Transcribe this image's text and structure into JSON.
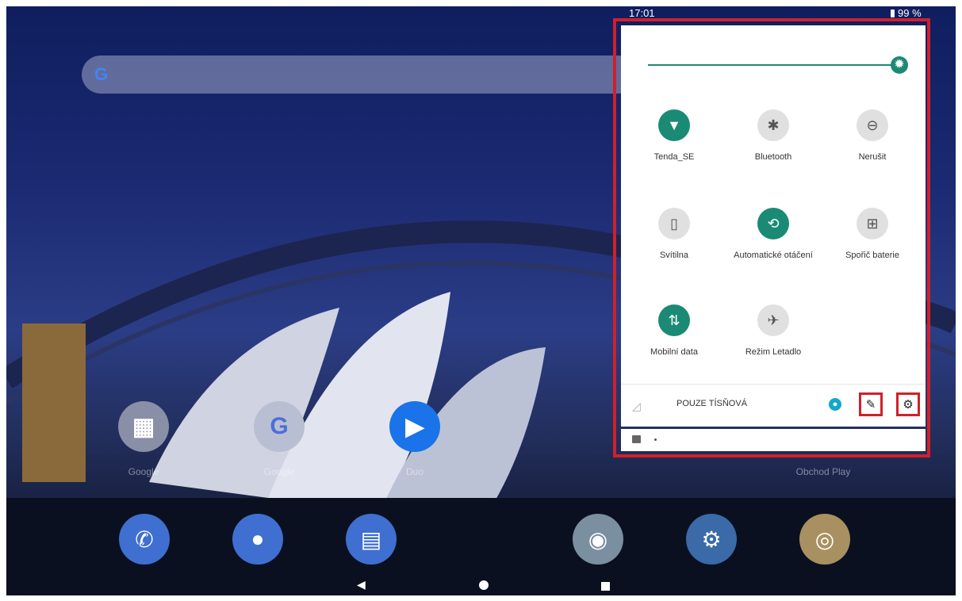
{
  "status_bar": {
    "time": "17:01",
    "battery": "99 %"
  },
  "home": {
    "apps": [
      {
        "label": "Google",
        "icon": "google-folder-icon",
        "color": "#8a8fa8"
      },
      {
        "label": "Google",
        "icon": "google-app-icon",
        "glyph": "G",
        "color": "#b9bfd3"
      },
      {
        "label": "Duo",
        "icon": "duo-icon",
        "color": "#1a73e8"
      },
      {
        "label": "Obchod Play",
        "icon": "play-store-icon",
        "color": "#9ba3bf"
      }
    ],
    "dock": [
      {
        "name": "phone",
        "icon": "phone-icon",
        "glyph": "✆",
        "color": "#3f6fd0"
      },
      {
        "name": "contacts",
        "icon": "contacts-icon",
        "glyph": "●",
        "color": "#3f6fd0"
      },
      {
        "name": "messages",
        "icon": "messages-icon",
        "glyph": "▤",
        "color": "#3f6fd0"
      },
      {
        "name": "chrome",
        "icon": "chrome-icon",
        "glyph": "◉",
        "color": "#7a8fa0"
      },
      {
        "name": "settings",
        "icon": "settings-icon",
        "glyph": "⚙",
        "color": "#3a6aa8"
      },
      {
        "name": "camera",
        "icon": "camera-icon",
        "glyph": "◎",
        "color": "#a89060"
      }
    ]
  },
  "quick_settings": {
    "brightness_level": 1.0,
    "accent_color": "#1b8a74",
    "tiles": [
      {
        "label": "Tenda_SE",
        "icon": "wifi-icon",
        "glyph": "▼",
        "state": "on"
      },
      {
        "label": "Bluetooth",
        "icon": "bluetooth-icon",
        "glyph": "✱",
        "state": "off"
      },
      {
        "label": "Nerušit",
        "icon": "do-not-disturb-icon",
        "glyph": "⊖",
        "state": "off"
      },
      {
        "label": "Svítilna",
        "icon": "flashlight-icon",
        "glyph": "▯",
        "state": "off"
      },
      {
        "label": "Automatické otáčení",
        "icon": "auto-rotate-icon",
        "glyph": "⟲",
        "state": "on"
      },
      {
        "label": "Spořič baterie",
        "icon": "battery-saver-icon",
        "glyph": "⊞",
        "state": "off"
      },
      {
        "label": "Mobilní data",
        "icon": "mobile-data-icon",
        "glyph": "⇅",
        "state": "on"
      },
      {
        "label": "Režim Letadlo",
        "icon": "airplane-icon",
        "glyph": "✈",
        "state": "off"
      }
    ],
    "footer": {
      "carrier_text": "POUZE TÍSŇOVÁ",
      "edit_glyph": "✎",
      "settings_glyph": "⚙"
    }
  },
  "highlight_color": "#d0202a"
}
